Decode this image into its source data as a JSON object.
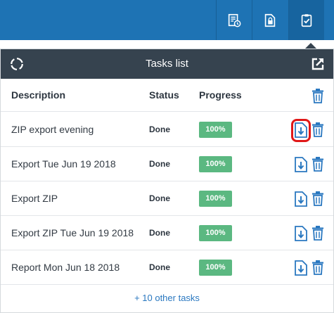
{
  "toolbar": {
    "icons": [
      "document-history-icon",
      "document-lock-icon",
      "clipboard-check-icon"
    ],
    "active_index": 2
  },
  "panel": {
    "title": "Tasks list",
    "refresh_icon": "refresh-icon",
    "open_icon": "external-link-icon"
  },
  "table": {
    "headers": {
      "description": "Description",
      "status": "Status",
      "progress": "Progress"
    },
    "rows": [
      {
        "description": "ZIP export evening",
        "status": "Done",
        "progress": "100%",
        "highlighted": true
      },
      {
        "description": "Export Tue Jun 19 2018",
        "status": "Done",
        "progress": "100%"
      },
      {
        "description": "Export ZIP",
        "status": "Done",
        "progress": "100%"
      },
      {
        "description": "Export ZIP Tue Jun 19 2018",
        "status": "Done",
        "progress": "100%"
      },
      {
        "description": "Report Mon Jun 18 2018",
        "status": "Done",
        "progress": "100%"
      }
    ],
    "more_link": "+ 10 other tasks"
  },
  "colors": {
    "topbar": "#1e73b4",
    "panel_header": "#36434f",
    "progress": "#5bb881",
    "icon_blue": "#2a78c0",
    "highlight": "#e01818"
  }
}
